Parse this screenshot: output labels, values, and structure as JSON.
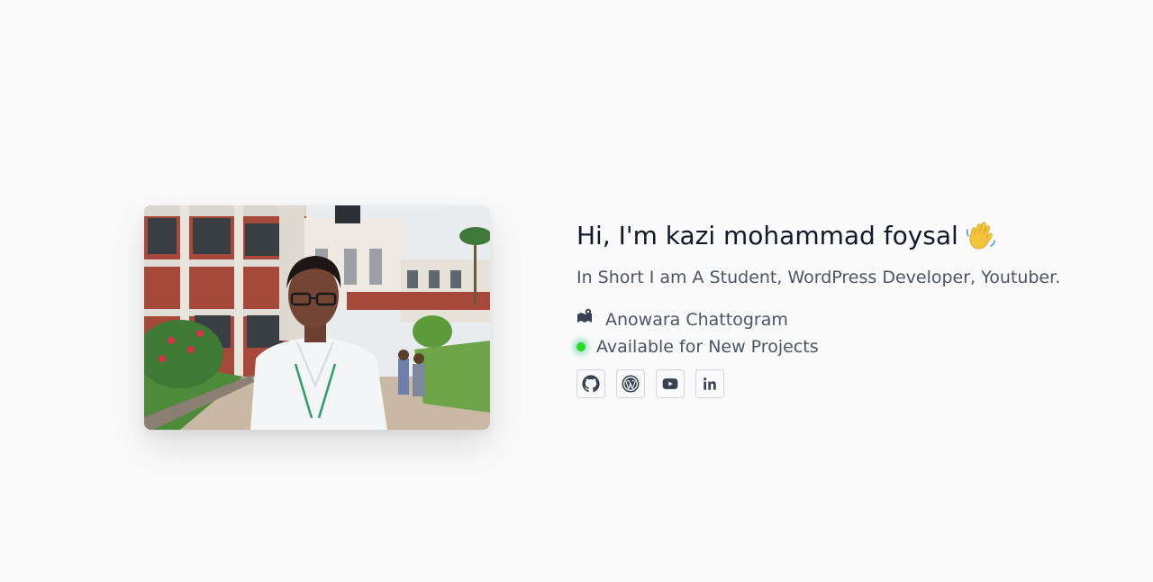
{
  "profile": {
    "greeting": "Hi, I'm kazi mohammad foysal",
    "wave_emoji": "👋",
    "tagline": "In Short I am A Student, WordPress Developer, Youtuber.",
    "location": "Anowara Chattogram",
    "availability": "Available for New Projects",
    "photo_alt": "kazi mohammad foysal"
  },
  "socials": [
    {
      "name": "github-icon"
    },
    {
      "name": "wordpress-icon"
    },
    {
      "name": "youtube-icon"
    },
    {
      "name": "linkedin-icon"
    }
  ],
  "colors": {
    "background": "#fafafa",
    "heading": "#111827",
    "body_text": "#4b5563",
    "status": "#22dd22",
    "icon": "#374151"
  }
}
